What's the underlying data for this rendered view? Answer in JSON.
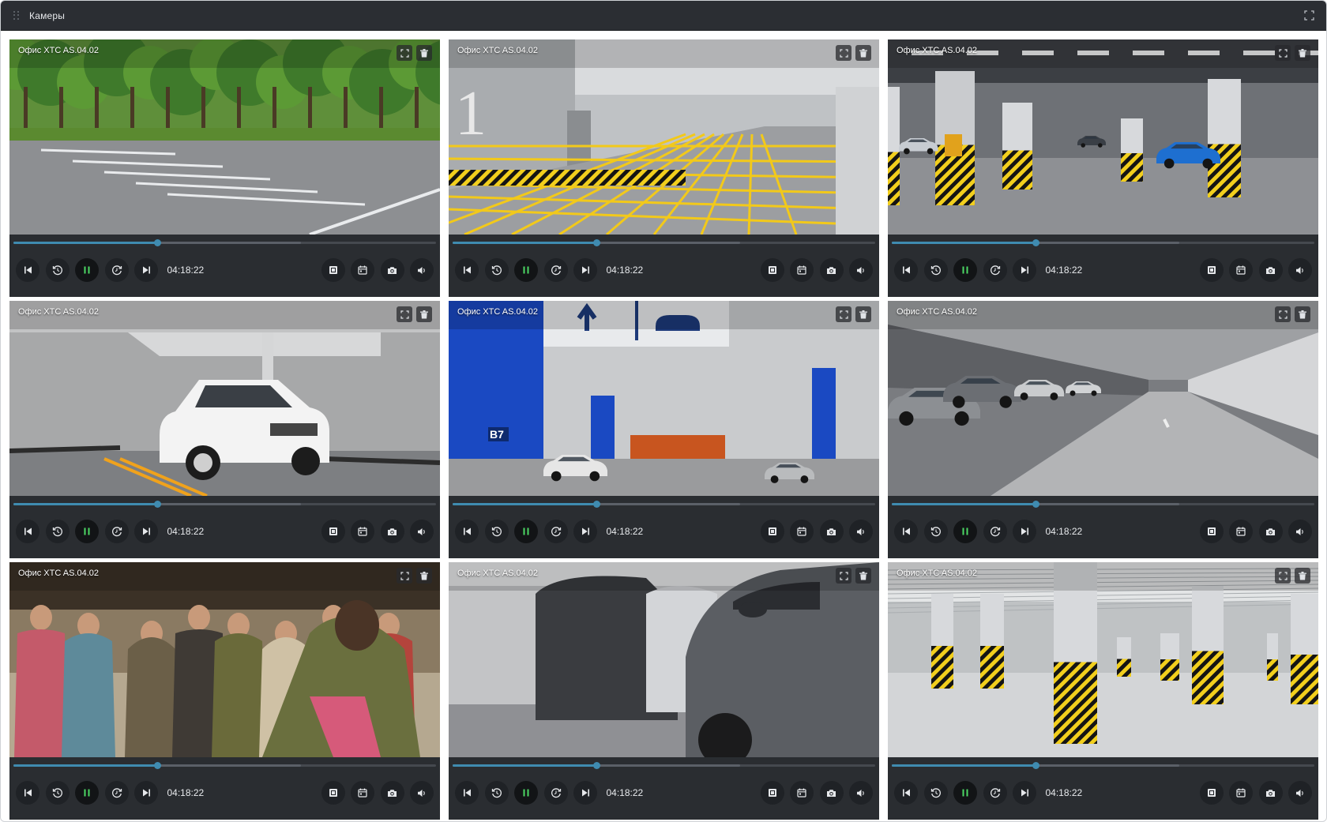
{
  "window": {
    "title": "Камеры"
  },
  "cameras": [
    {
      "label": "Офис XTC AS.04.02",
      "time": "04:18:22",
      "progress": 0.34,
      "buffered": 0.68,
      "scene": "outdoor-lot"
    },
    {
      "label": "Офис XTC AS.04.02",
      "time": "04:18:22",
      "progress": 0.34,
      "buffered": 0.68,
      "scene": "ramp"
    },
    {
      "label": "Офис XTC AS.04.02",
      "time": "04:18:22",
      "progress": 0.34,
      "buffered": 0.68,
      "scene": "garage-red"
    },
    {
      "label": "Офис XTC AS.04.02",
      "time": "04:18:22",
      "progress": 0.34,
      "buffered": 0.68,
      "scene": "white-car"
    },
    {
      "label": "Офис XTC AS.04.02",
      "time": "04:18:22",
      "progress": 0.34,
      "buffered": 0.68,
      "scene": "blue-garage"
    },
    {
      "label": "Офис XTC AS.04.02",
      "time": "04:18:22",
      "progress": 0.34,
      "buffered": 0.68,
      "scene": "row-cars"
    },
    {
      "label": "Офис XTC AS.04.02",
      "time": "04:18:22",
      "progress": 0.34,
      "buffered": 0.68,
      "scene": "crowd"
    },
    {
      "label": "Офис XTC AS.04.02",
      "time": "04:18:22",
      "progress": 0.34,
      "buffered": 0.68,
      "scene": "cars-closeup"
    },
    {
      "label": "Офис XTC AS.04.02",
      "time": "04:18:22",
      "progress": 0.34,
      "buffered": 0.68,
      "scene": "yellow-pillars"
    }
  ],
  "icons": {
    "fullscreen": "fullscreen-icon",
    "delete": "trash-icon",
    "skip_back": "skip-back-icon",
    "rewind": "rewind-icon",
    "pause": "pause-icon",
    "forward": "forward-icon",
    "skip_forward": "skip-forward-icon",
    "archive": "archive-icon",
    "calendar": "calendar-icon",
    "snapshot": "camera-icon",
    "volume": "volume-icon"
  },
  "colors": {
    "accent": "#3f8bb0",
    "pause": "#4cd964",
    "panel": "#2a2d31",
    "titlebar": "#2b2e33"
  }
}
